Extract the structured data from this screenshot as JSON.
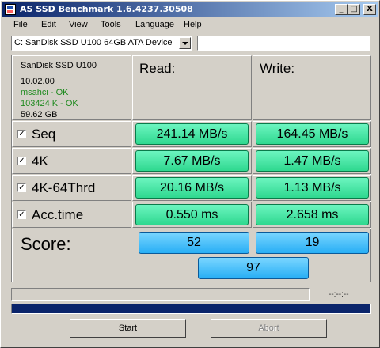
{
  "window": {
    "title": "AS SSD Benchmark  1.6.4237.30508",
    "controls": {
      "minimize": "_",
      "maximize": "□",
      "close": "X"
    }
  },
  "menu": [
    "File",
    "Edit",
    "View",
    "Tools",
    "Language",
    "Help"
  ],
  "drive": {
    "selected": "C: SanDisk SSD U100 64GB ATA Device",
    "field_value": ""
  },
  "info": {
    "model": "SanDisk SSD U100",
    "firmware": "10.02.00",
    "driver_status": "msahci - OK",
    "alignment_status": "103424 K - OK",
    "capacity": "59.62 GB"
  },
  "headers": {
    "read": "Read:",
    "write": "Write:"
  },
  "rows": [
    {
      "label": "Seq",
      "checked": true,
      "read": "241.14 MB/s",
      "write": "164.45 MB/s"
    },
    {
      "label": "4K",
      "checked": true,
      "read": "7.67 MB/s",
      "write": "1.47 MB/s"
    },
    {
      "label": "4K-64Thrd",
      "checked": true,
      "read": "20.16 MB/s",
      "write": "1.13 MB/s"
    },
    {
      "label": "Acc.time",
      "checked": true,
      "read": "0.550 ms",
      "write": "2.658 ms"
    }
  ],
  "check_glyph": "✓",
  "score": {
    "label": "Score:",
    "read": "52",
    "write": "19",
    "total": "97"
  },
  "status": {
    "time": "--:--:--",
    "progress": 1.0
  },
  "buttons": {
    "start": "Start",
    "abort": "Abort"
  },
  "colors": {
    "title_start": "#0a246a",
    "title_end": "#a6caf0",
    "result_green": "#2fd88f",
    "score_blue": "#27aef5",
    "progress": "#0a246a",
    "status_ok": "#1f8a1f"
  }
}
